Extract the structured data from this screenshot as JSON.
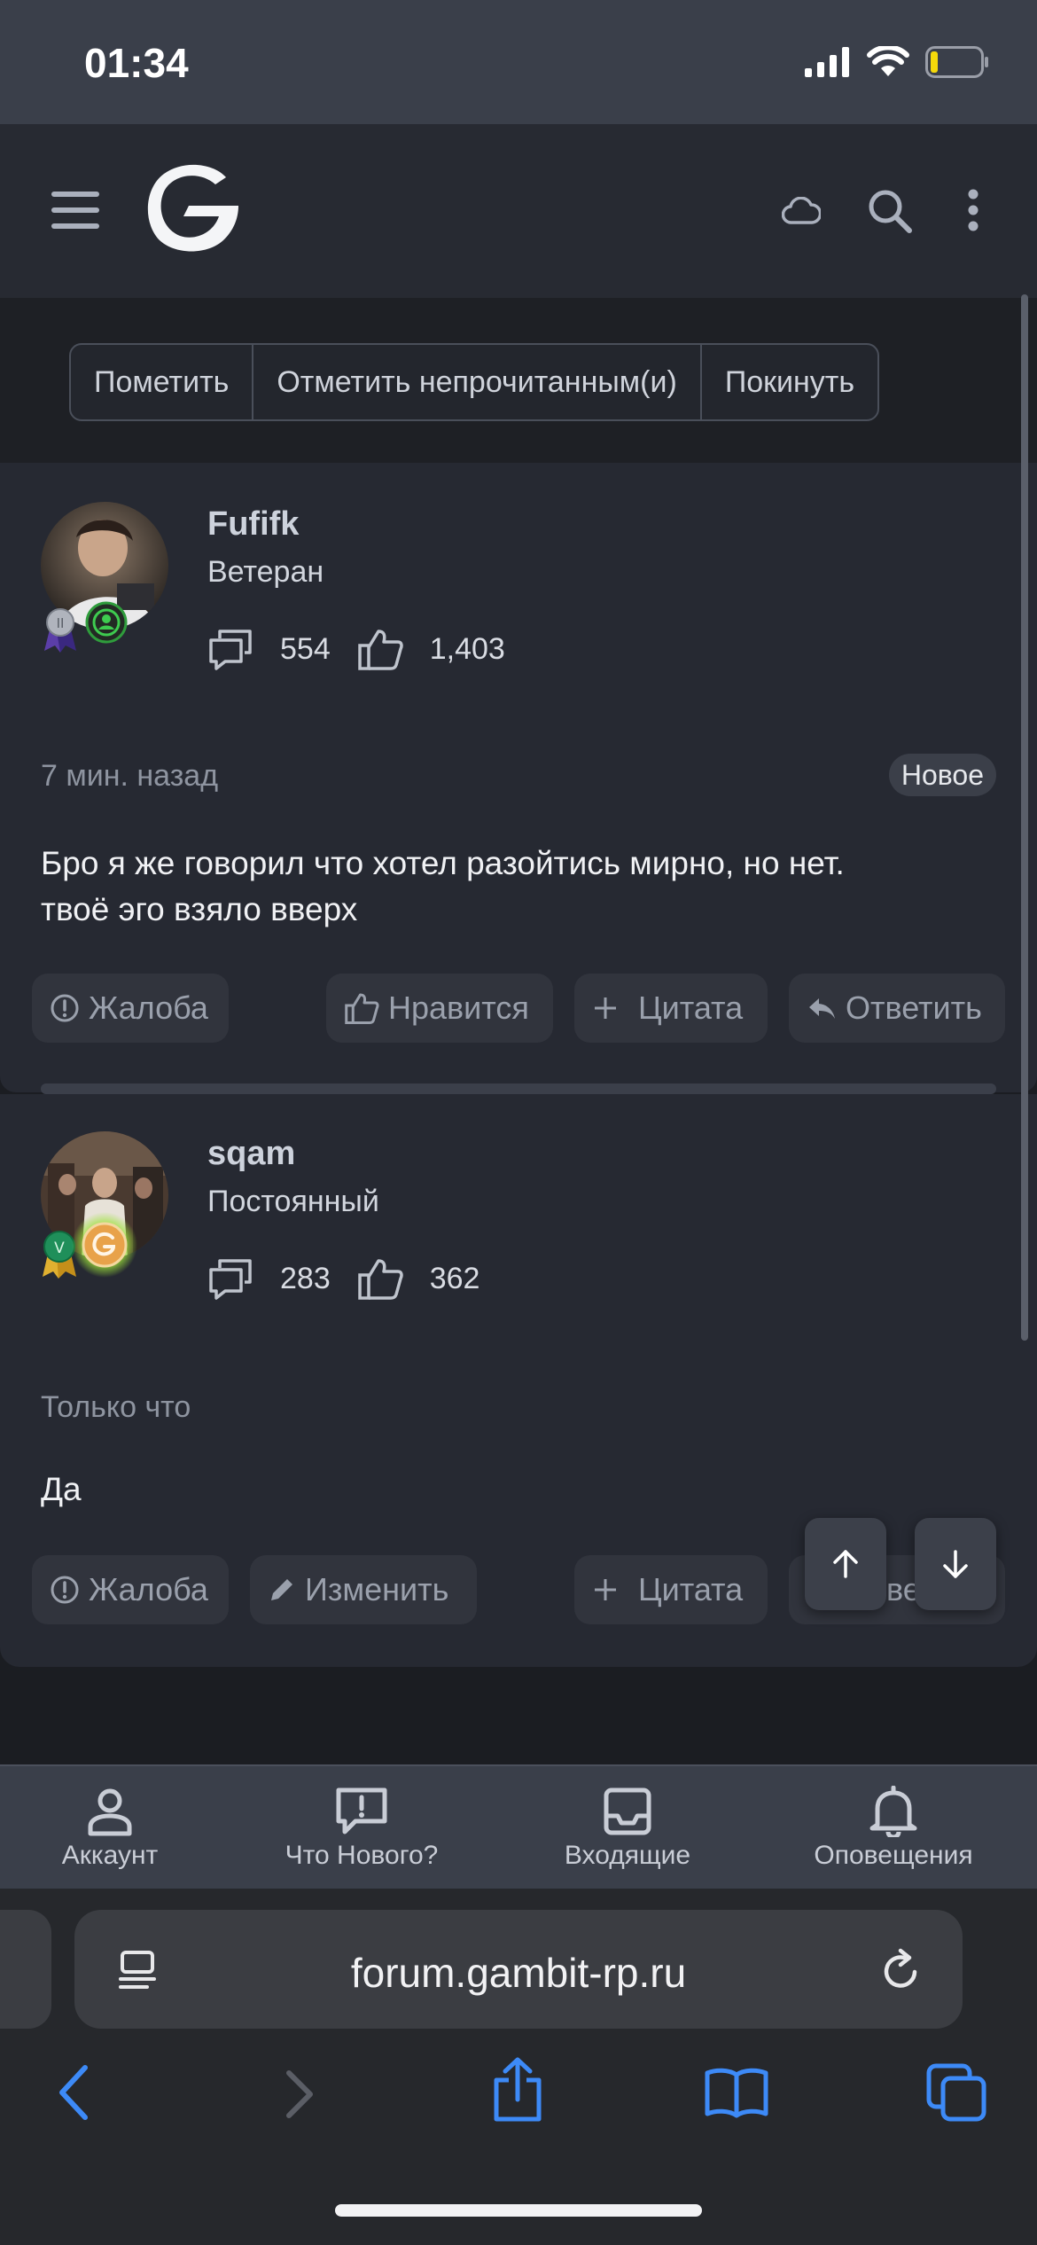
{
  "status": {
    "time": "01:34"
  },
  "header": {
    "logo_alt": "gambit-logo"
  },
  "thread_actions": {
    "buttons": [
      "Пометить",
      "Отметить непрочитанным(и)",
      "Покинуть"
    ]
  },
  "posts": [
    {
      "username": "Fufifk",
      "role": "Ветеран",
      "messages_count": "554",
      "likes_count": "1,403",
      "time": "7 мин. назад",
      "badge": "Новое",
      "text_line1": "Бро я же говорил что хотел разойтись мирно, но нет.",
      "text_line2": "твоё эго взяло вверх",
      "actions": {
        "report": "Жалоба",
        "like": "Нравится",
        "quote": "Цитата",
        "reply": "Ответить"
      }
    },
    {
      "username": "sqam",
      "role": "Постоянный",
      "messages_count": "283",
      "likes_count": "362",
      "time": "Только что",
      "text": "Да",
      "actions": {
        "report": "Жалоба",
        "edit": "Изменить",
        "quote": "Цитата",
        "reply_partial": "ве"
      }
    }
  ],
  "tabbar": {
    "items": [
      "Аккаунт",
      "Что Нового?",
      "Входящие",
      "Оповещения"
    ]
  },
  "browser": {
    "url": "forum.gambit-rp.ru",
    "accent_color": "#3d8af7"
  }
}
